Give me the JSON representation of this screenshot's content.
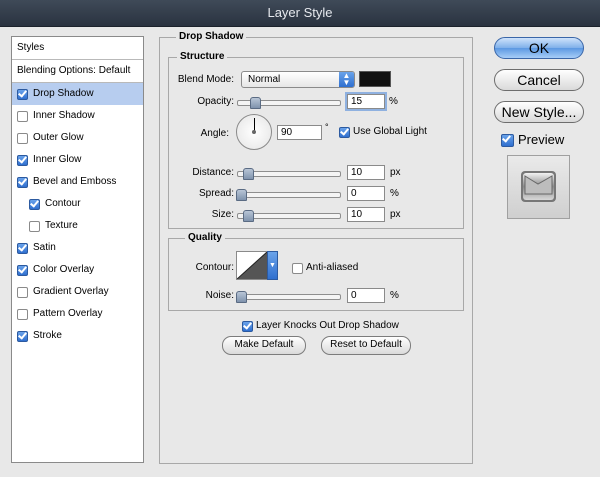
{
  "window": {
    "title": "Layer Style"
  },
  "styles_list": {
    "header": "Styles",
    "items": [
      {
        "label": "Blending Options: Default",
        "checkbox": false,
        "checked": false,
        "selected": false,
        "indent": false
      },
      {
        "label": "Drop Shadow",
        "checkbox": true,
        "checked": true,
        "selected": true,
        "indent": false
      },
      {
        "label": "Inner Shadow",
        "checkbox": true,
        "checked": false,
        "selected": false,
        "indent": false
      },
      {
        "label": "Outer Glow",
        "checkbox": true,
        "checked": false,
        "selected": false,
        "indent": false
      },
      {
        "label": "Inner Glow",
        "checkbox": true,
        "checked": true,
        "selected": false,
        "indent": false
      },
      {
        "label": "Bevel and Emboss",
        "checkbox": true,
        "checked": true,
        "selected": false,
        "indent": false
      },
      {
        "label": "Contour",
        "checkbox": true,
        "checked": true,
        "selected": false,
        "indent": true
      },
      {
        "label": "Texture",
        "checkbox": true,
        "checked": false,
        "selected": false,
        "indent": true
      },
      {
        "label": "Satin",
        "checkbox": true,
        "checked": true,
        "selected": false,
        "indent": false
      },
      {
        "label": "Color Overlay",
        "checkbox": true,
        "checked": true,
        "selected": false,
        "indent": false
      },
      {
        "label": "Gradient Overlay",
        "checkbox": true,
        "checked": false,
        "selected": false,
        "indent": false
      },
      {
        "label": "Pattern Overlay",
        "checkbox": true,
        "checked": false,
        "selected": false,
        "indent": false
      },
      {
        "label": "Stroke",
        "checkbox": true,
        "checked": true,
        "selected": false,
        "indent": false
      }
    ]
  },
  "drop_shadow": {
    "title": "Drop Shadow",
    "structure": {
      "title": "Structure",
      "blend_mode_label": "Blend Mode:",
      "blend_mode_value": "Normal",
      "shadow_color": "#111111",
      "opacity_label": "Opacity:",
      "opacity_value": "15",
      "opacity_unit": "%",
      "angle_label": "Angle:",
      "angle_value": "90",
      "angle_unit": "°",
      "use_global_light_label": "Use Global Light",
      "use_global_light_checked": true,
      "distance_label": "Distance:",
      "distance_value": "10",
      "distance_unit": "px",
      "spread_label": "Spread:",
      "spread_value": "0",
      "spread_unit": "%",
      "size_label": "Size:",
      "size_value": "10",
      "size_unit": "px"
    },
    "quality": {
      "title": "Quality",
      "contour_label": "Contour:",
      "anti_aliased_label": "Anti-aliased",
      "anti_aliased_checked": false,
      "noise_label": "Noise:",
      "noise_value": "0",
      "noise_unit": "%"
    },
    "knockout_label": "Layer Knocks Out Drop Shadow",
    "knockout_checked": true,
    "make_default_label": "Make Default",
    "reset_default_label": "Reset to Default"
  },
  "buttons": {
    "ok": "OK",
    "cancel": "Cancel",
    "new_style": "New Style..."
  },
  "preview": {
    "label": "Preview",
    "checked": true
  },
  "colors": {
    "selection": "#b7cdef",
    "accent": "#2f6fcf",
    "titlebar": "#2a3340"
  }
}
